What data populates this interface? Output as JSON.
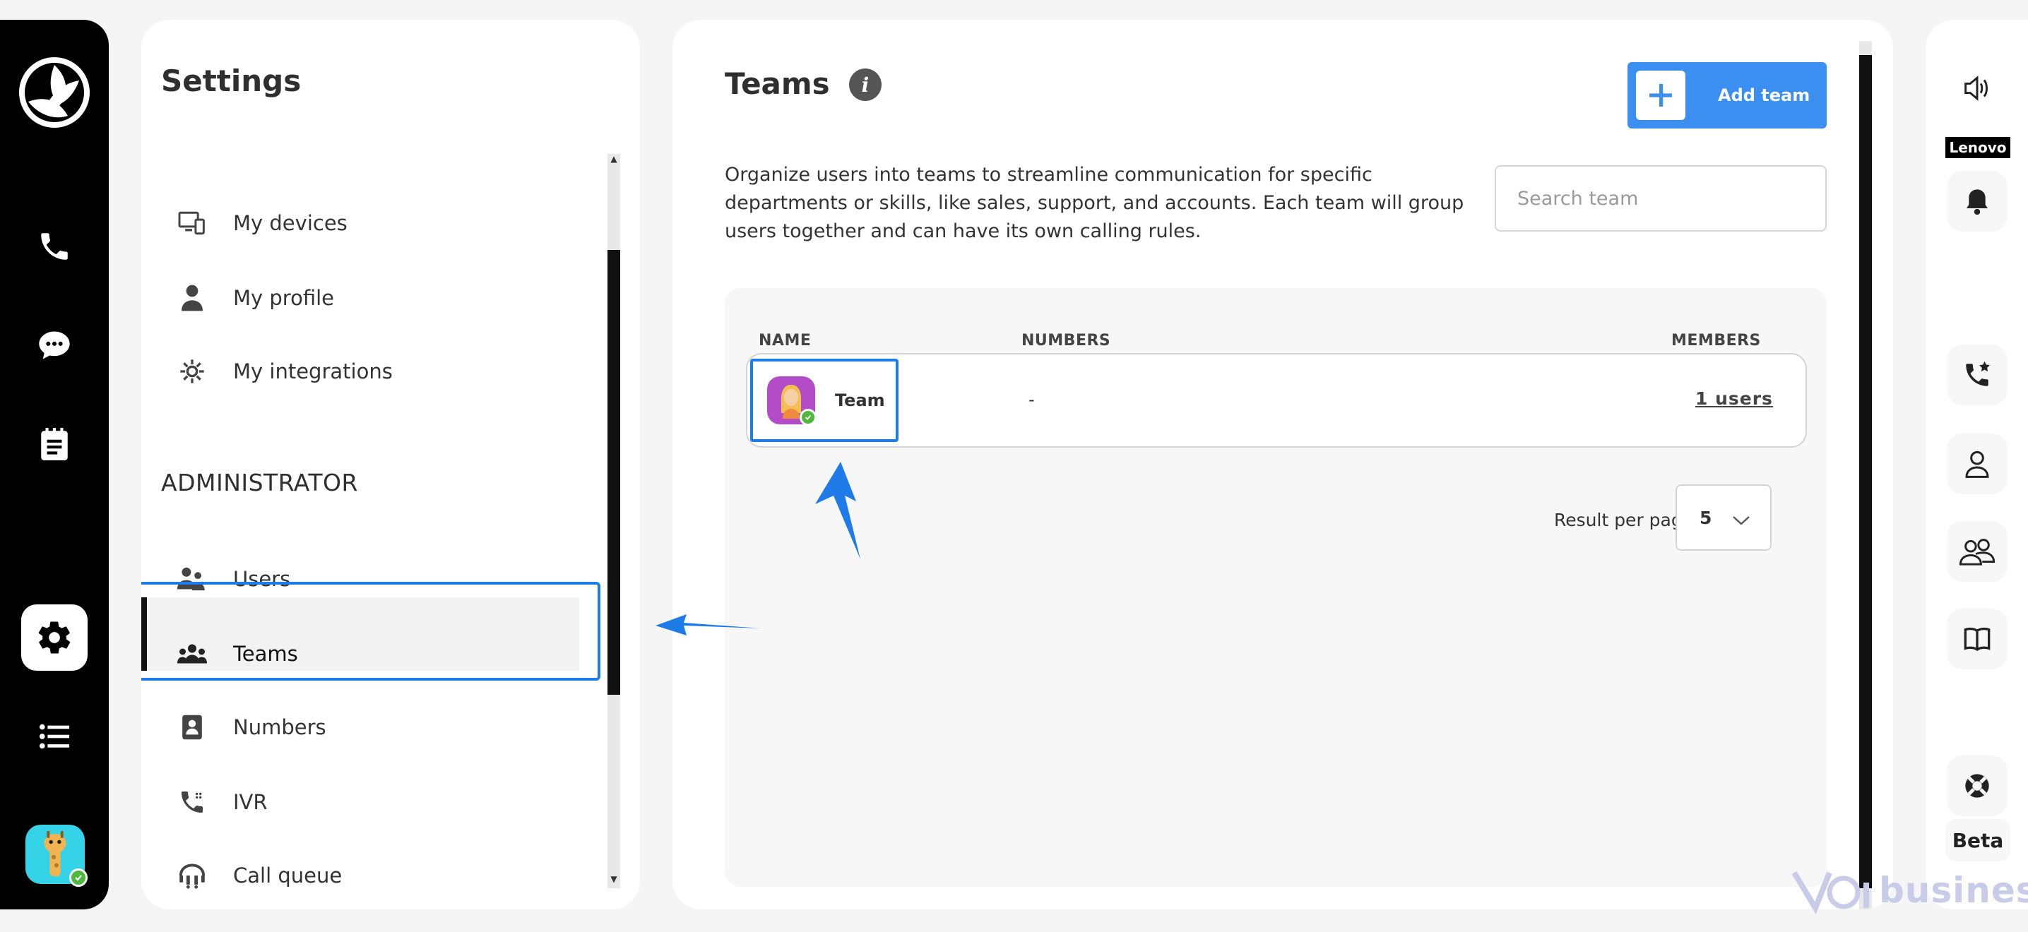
{
  "settings": {
    "title": "Settings",
    "items_personal": [
      {
        "label": "My devices",
        "icon": "devices-icon"
      },
      {
        "label": "My profile",
        "icon": "person-icon"
      },
      {
        "label": "My integrations",
        "icon": "integrations-icon"
      }
    ],
    "admin_section": "ADMINISTRATOR",
    "items_admin": [
      {
        "label": "Users",
        "icon": "users-icon"
      },
      {
        "label": "Teams",
        "icon": "teams-icon",
        "active": true
      },
      {
        "label": "Numbers",
        "icon": "numbers-icon"
      },
      {
        "label": "IVR",
        "icon": "ivr-icon"
      },
      {
        "label": "Call queue",
        "icon": "call-queue-icon"
      }
    ]
  },
  "main": {
    "title": "Teams",
    "add_button": "Add team",
    "description": "Organize users into teams to streamline communication for specific departments or skills, like sales, support, and accounts. Each team will group users together and can have its own calling rules.",
    "search_placeholder": "Search team",
    "table": {
      "columns": [
        "NAME",
        "NUMBERS",
        "MEMBERS"
      ],
      "rows": [
        {
          "name": "Team",
          "numbers": "-",
          "members": "1 users"
        }
      ]
    },
    "result_per_page_label": "Result per page",
    "result_per_page_value": "5"
  },
  "right_rail": {
    "device_label": "Lenovo",
    "beta_label": "Beta"
  },
  "watermark": "business",
  "colors": {
    "accent": "#3a8ff0",
    "highlight": "#1f7be8",
    "online": "#4fb83d",
    "rail": "#000000"
  }
}
